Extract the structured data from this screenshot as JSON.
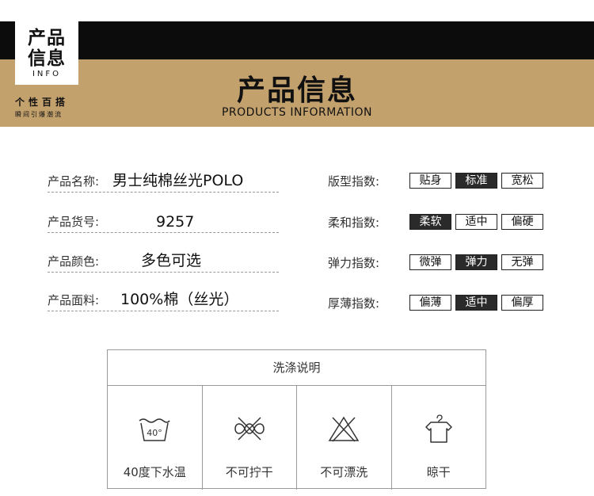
{
  "header": {
    "badge_line1": "产品",
    "badge_line2": "信息",
    "badge_line3": "INFO",
    "slogan_main": "个性百搭",
    "slogan_sub": "瞬间引爆潮流",
    "title": "产品信息",
    "subtitle": "PRODUCTS INFORMATION"
  },
  "specs": [
    {
      "label": "产品名称:",
      "value": "男士纯棉丝光POLO"
    },
    {
      "label": "产品货号:",
      "value": "9257"
    },
    {
      "label": "产品颜色:",
      "value": "多色可选"
    },
    {
      "label": "产品面料:",
      "value": "100%棉（丝光）"
    }
  ],
  "indices": [
    {
      "label": "版型指数:",
      "options": [
        "贴身",
        "标准",
        "宽松"
      ],
      "selected": 1
    },
    {
      "label": "柔和指数:",
      "options": [
        "柔软",
        "适中",
        "偏硬"
      ],
      "selected": 0
    },
    {
      "label": "弹力指数:",
      "options": [
        "微弹",
        "弹力",
        "无弹"
      ],
      "selected": 1
    },
    {
      "label": "厚薄指数:",
      "options": [
        "偏薄",
        "适中",
        "偏厚"
      ],
      "selected": 1
    }
  ],
  "care": {
    "title": "洗涤说明",
    "items": [
      {
        "label": "40度下水温",
        "icon": "wash-40-icon",
        "icon_text": "40°"
      },
      {
        "label": "不可拧干",
        "icon": "no-wring-icon"
      },
      {
        "label": "不可漂洗",
        "icon": "no-bleach-icon"
      },
      {
        "label": "晾干",
        "icon": "hang-dry-icon"
      }
    ]
  },
  "colors": {
    "banner_black": "#0c0c0c",
    "banner_tan": "#c3a16d",
    "selected_option": "#2a2a2a"
  }
}
